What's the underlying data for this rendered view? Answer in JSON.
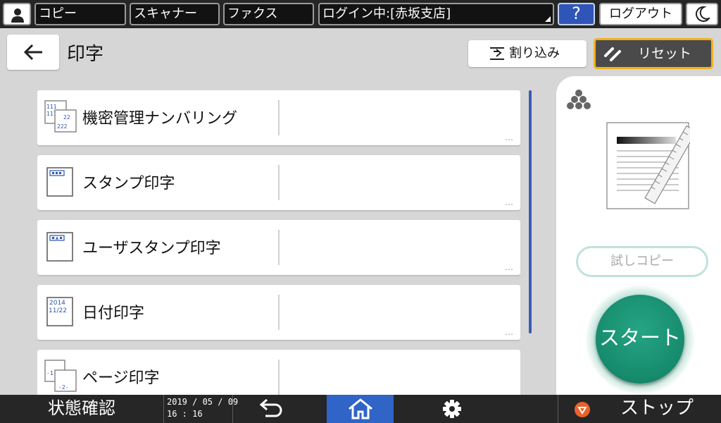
{
  "topbar": {
    "copy": "コピー",
    "scanner": "スキャナー",
    "fax": "ファクス",
    "login_status": "ログイン中:[赤坂支店]",
    "help": "?",
    "logout": "ログアウト"
  },
  "header": {
    "title": "印字",
    "interrupt": "割り込み",
    "reset": "リセット"
  },
  "list": {
    "items": [
      {
        "label": "機密管理ナンバリング",
        "icon": "numbering-icon",
        "icon_text": [
          "111",
          "111",
          "22",
          "222"
        ]
      },
      {
        "label": "スタンプ印字",
        "icon": "stamp-icon"
      },
      {
        "label": "ユーザスタンプ印字",
        "icon": "user-stamp-icon"
      },
      {
        "label": "日付印字",
        "icon": "date-stamp-icon",
        "icon_text": [
          "2014",
          "11/22"
        ]
      },
      {
        "label": "ページ印字",
        "icon": "page-number-icon",
        "icon_text": [
          "-1-",
          "-2-"
        ]
      }
    ],
    "more": "…"
  },
  "right_panel": {
    "trial_copy": "試しコピー",
    "start": "スタート"
  },
  "bottombar": {
    "status": "状態確認",
    "date": "2019 / 05 / 09",
    "time": "16 : 16",
    "stop": "ストップ"
  },
  "colors": {
    "bar_bg": "#262626",
    "accent_blue": "#3064c6",
    "reset_border": "#f2b21c",
    "start_green": "#168a6c",
    "stop_orange": "#e8632b"
  }
}
